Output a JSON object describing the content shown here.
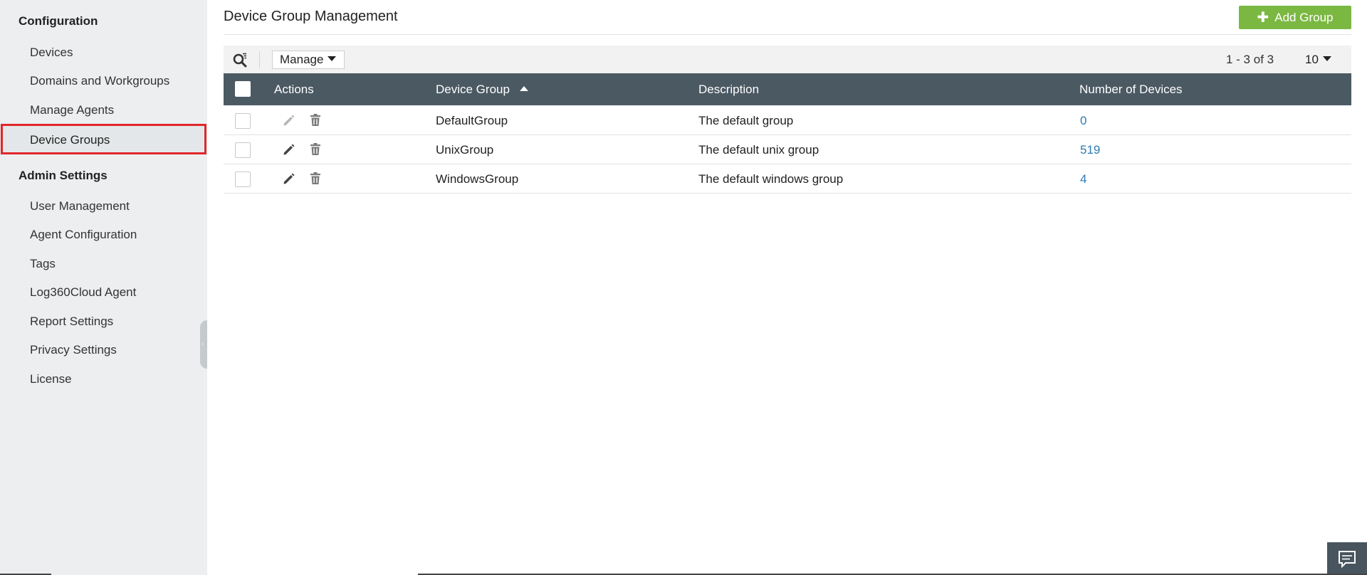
{
  "sidebar": {
    "sections": [
      {
        "title": "Configuration",
        "items": [
          {
            "label": "Devices"
          },
          {
            "label": "Domains and Workgroups"
          },
          {
            "label": "Manage Agents"
          },
          {
            "label": "Device Groups",
            "active": true
          }
        ]
      },
      {
        "title": "Admin Settings",
        "items": [
          {
            "label": "User Management"
          },
          {
            "label": "Agent Configuration"
          },
          {
            "label": "Tags"
          },
          {
            "label": "Log360Cloud Agent"
          },
          {
            "label": "Report Settings"
          },
          {
            "label": "Privacy Settings"
          },
          {
            "label": "License"
          }
        ]
      }
    ]
  },
  "header": {
    "title": "Device Group Management",
    "add_button_label": "Add Group"
  },
  "toolbar": {
    "manage_label": "Manage",
    "pagination_text": "1 - 3 of 3",
    "per_page": "10"
  },
  "table": {
    "columns": [
      "Actions",
      "Device Group",
      "Description",
      "Number of Devices"
    ],
    "sorted_column": "Device Group",
    "sort_direction": "ascending",
    "rows": [
      {
        "group": "DefaultGroup",
        "description": "The default group",
        "count": "0",
        "editable": false
      },
      {
        "group": "UnixGroup",
        "description": "The default unix group",
        "count": "519",
        "editable": true
      },
      {
        "group": "WindowsGroup",
        "description": "The default windows group",
        "count": "4",
        "editable": true
      }
    ]
  },
  "colors": {
    "accent_add": "#7bb842",
    "header_bg": "#4b5963",
    "active_border": "#e1262c",
    "link": "#2c7bb3",
    "sidebar_bg": "#eceeef"
  },
  "icons": {
    "search": "search-filter-icon",
    "edit": "pencil-icon",
    "delete": "trash-icon",
    "add": "plus-icon",
    "chat": "chat-icon"
  }
}
